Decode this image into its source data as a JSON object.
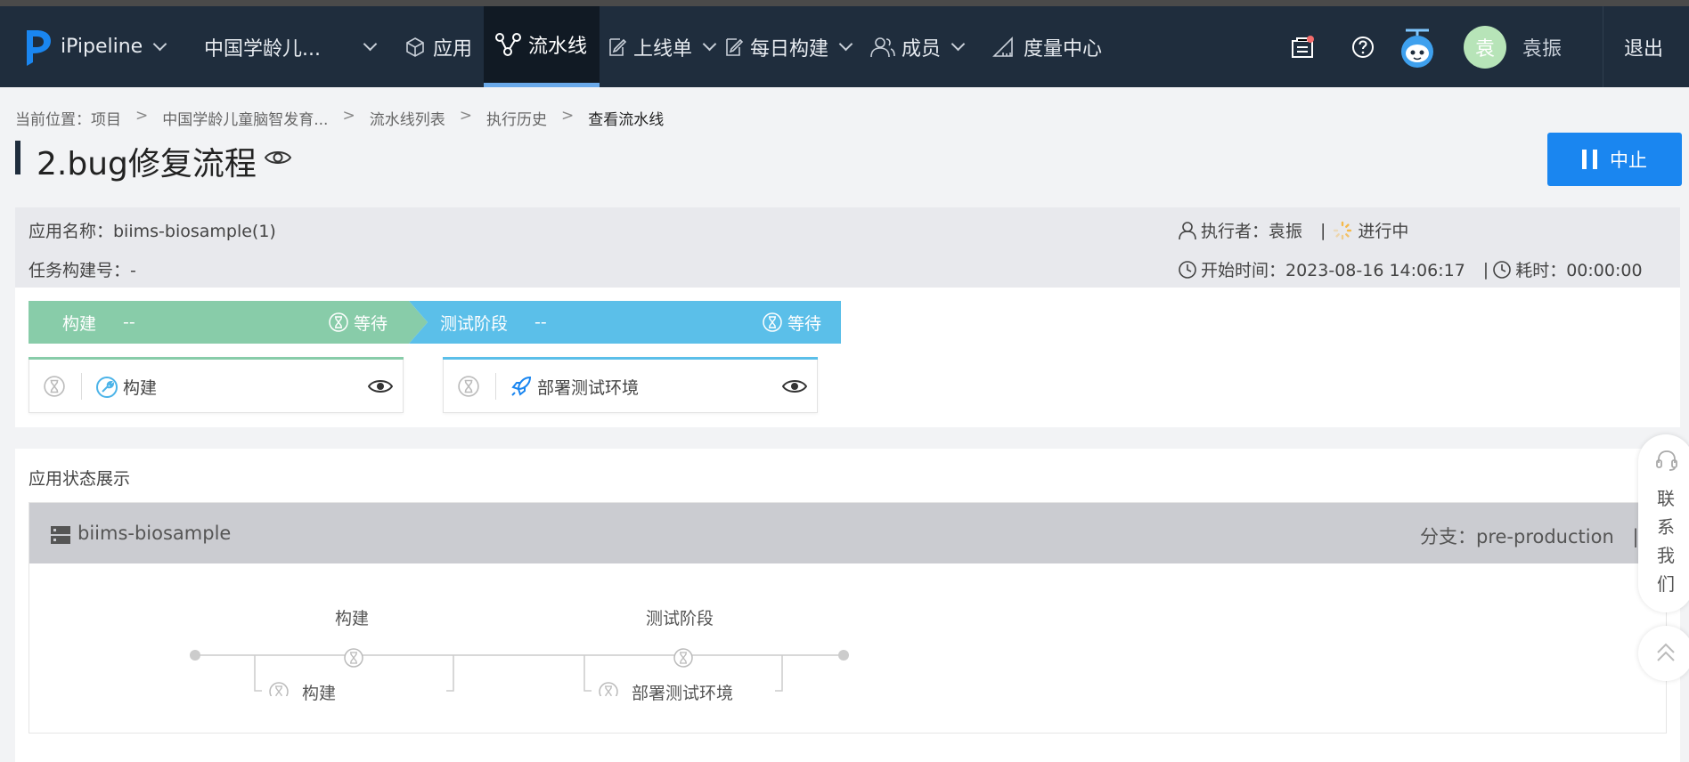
{
  "nav": {
    "logo_text": "iPipeline",
    "project_select": "中国学龄儿...",
    "items": [
      {
        "label": "应用"
      },
      {
        "label": "流水线"
      },
      {
        "label": "上线单"
      },
      {
        "label": "每日构建"
      },
      {
        "label": "成员"
      },
      {
        "label": "度量中心"
      }
    ],
    "active_item": "流水线",
    "user_avatar_text": "袁",
    "user_name": "袁振",
    "logout": "退出",
    "accent": "#6aa9e9",
    "bg": "#1f2d3d"
  },
  "breadcrumb": {
    "prefix": "当前位置：",
    "items": [
      "项目",
      "中国学龄儿童脑智发育...",
      "流水线列表",
      "执行历史",
      "查看流水线"
    ],
    "separator": ">"
  },
  "page": {
    "title": "2.bug修复流程",
    "stop_button": "中止",
    "stop_color": "#1a86f0"
  },
  "info": {
    "app_name": "应用名称：biims-biosample(1)",
    "build_no": "任务构建号：-",
    "executor": "执行者：袁振",
    "sep": "|",
    "status": "进行中",
    "start_time": "开始时间：2023-08-16 14:06:17",
    "duration": "耗时：00:00:00"
  },
  "stages": [
    {
      "name": "构建",
      "value": "--",
      "state": "等待",
      "color": "#88cca9",
      "job": "构建",
      "job_icon": "wrench-icon"
    },
    {
      "name": "测试阶段",
      "value": "--",
      "state": "等待",
      "color": "#5bbfe9",
      "job": "部署测试环境",
      "job_icon": "rocket-icon"
    }
  ],
  "app_status": {
    "section_title": "应用状态展示",
    "app_name": "biims-biosample",
    "branch": "分支：pre-production",
    "branch_sep": "|",
    "flow": [
      {
        "stage": "构建",
        "job": "构建"
      },
      {
        "stage": "测试阶段",
        "job": "部署测试环境"
      }
    ]
  },
  "float": {
    "contact_chars": [
      "联",
      "系",
      "我",
      "们"
    ]
  }
}
